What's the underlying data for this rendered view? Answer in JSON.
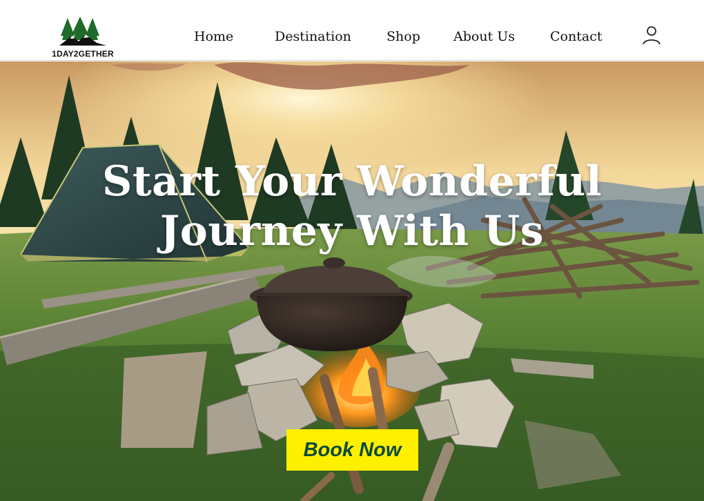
{
  "brand": {
    "name": "1DAY2GETHER"
  },
  "nav": {
    "items": [
      {
        "label": "Home"
      },
      {
        "label": "Destination"
      },
      {
        "label": "Shop"
      },
      {
        "label": "About Us"
      },
      {
        "label": "Contact"
      }
    ]
  },
  "hero": {
    "headline_line1": "Start Your Wonderful",
    "headline_line2": "Journey With Us",
    "cta_label": "Book Now"
  },
  "icons": {
    "logo": "pine-trees-mountain-logo",
    "account": "user-icon"
  },
  "colors": {
    "cta_bg": "#fff000",
    "cta_text": "#0d4a3a",
    "header_bg": "#ffffff"
  }
}
